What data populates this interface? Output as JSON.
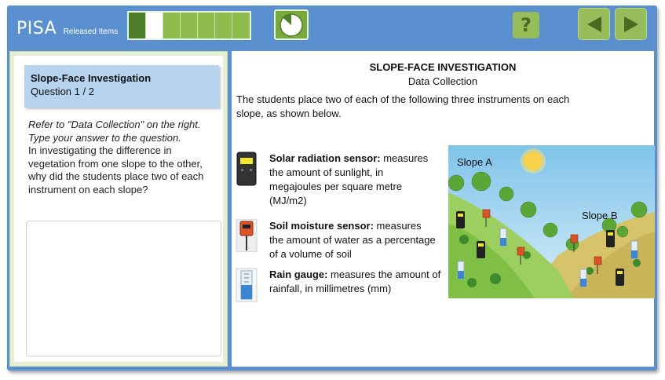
{
  "header": {
    "logo": "PISA",
    "logo_sub": "Released Items",
    "progress": {
      "total": 7,
      "done": 1,
      "current": 2
    },
    "help_label": "?"
  },
  "question": {
    "title": "Slope-Face Investigation",
    "number": "Question 1 / 2",
    "instruction": "Refer to \"Data Collection\" on the right. Type your answer to the question.",
    "text": "In investigating the difference in vegetation from one slope to the other, why did the students place two of each instrument  on each slope?",
    "answer_value": ""
  },
  "stimulus": {
    "title": "SLOPE-FACE INVESTIGATION",
    "subtitle": "Data Collection",
    "intro": "The students place two of each of the following three instruments on each slope, as shown below.",
    "instruments": [
      {
        "name": "Solar radiation sensor:",
        "desc": " measures the amount of sunlight, in megajoules per square metre (MJ/m2)",
        "icon": "solar-sensor-icon"
      },
      {
        "name": "Soil moisture sensor:",
        "desc": " measures the amount of water as a percentage of a volume of soil",
        "icon": "soil-sensor-icon"
      },
      {
        "name": "Rain gauge:",
        "desc": " measures the amount of rainfall, in millimetres (mm)",
        "icon": "rain-gauge-icon"
      }
    ],
    "scene": {
      "slope_a": "Slope A",
      "slope_b": "Slope B"
    }
  }
}
